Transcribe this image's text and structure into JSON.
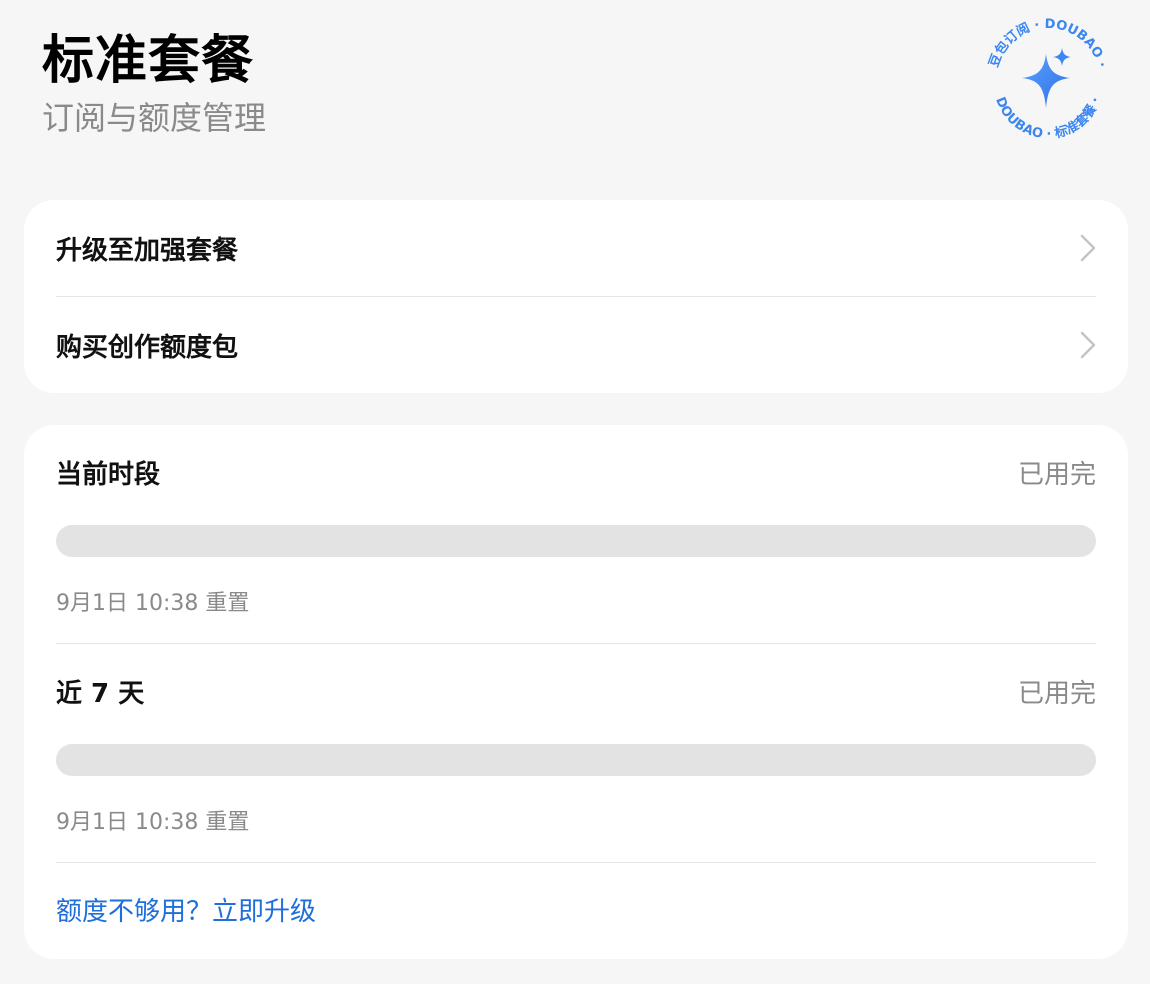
{
  "header": {
    "title": "标准套餐",
    "subtitle": "订阅与额度管理"
  },
  "seal": {
    "text_top": "豆包订阅 · DOUBAO ·",
    "text_bottom": "DOUBAO · 标准套餐 ·",
    "icon": "sparkle-star-icon",
    "color": "#3b86f0"
  },
  "actions": [
    {
      "label": "升级至加强套餐",
      "icon": "chevron-right-icon"
    },
    {
      "label": "购买创作额度包",
      "icon": "chevron-right-icon"
    }
  ],
  "usage": [
    {
      "title": "当前时段",
      "status": "已用完",
      "progress_used_fraction": 1.0,
      "reset": "9月1日 10:38 重置"
    },
    {
      "title": "近 7 天",
      "status": "已用完",
      "progress_used_fraction": 1.0,
      "reset": "9月1日 10:38 重置"
    }
  ],
  "upgrade_link": "额度不够用？立即升级",
  "colors": {
    "background": "#f6f6f6",
    "card": "#ffffff",
    "accent": "#1f6fdb",
    "muted_text": "#8a8a8a",
    "progress_track": "#e3e3e3"
  }
}
